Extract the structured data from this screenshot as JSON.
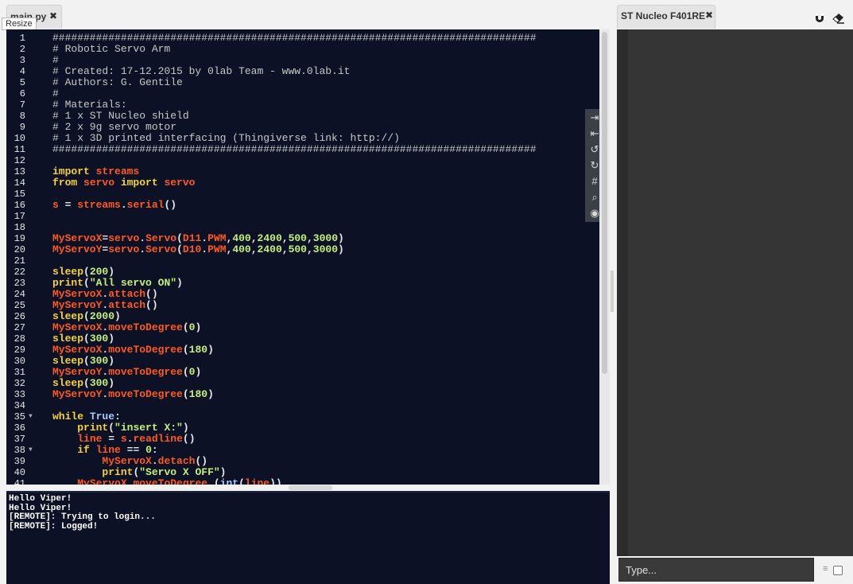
{
  "editor_tab": {
    "label": "main.py",
    "close": "✖"
  },
  "resize_tooltip": "Resize",
  "code_lines": [
    {
      "n": "1",
      "tokens": [
        {
          "c": "comment",
          "t": "##############################################################################"
        }
      ]
    },
    {
      "n": "2",
      "tokens": [
        {
          "c": "comment",
          "t": "# Robotic Servo Arm"
        }
      ]
    },
    {
      "n": "3",
      "tokens": [
        {
          "c": "comment",
          "t": "#"
        }
      ]
    },
    {
      "n": "4",
      "tokens": [
        {
          "c": "comment",
          "t": "# Created: 17-12.2015 by 0lab Team - www.0lab.it"
        }
      ]
    },
    {
      "n": "5",
      "tokens": [
        {
          "c": "comment",
          "t": "# Authors: G. Gentile"
        }
      ]
    },
    {
      "n": "6",
      "tokens": [
        {
          "c": "comment",
          "t": "#"
        }
      ]
    },
    {
      "n": "7",
      "tokens": [
        {
          "c": "comment",
          "t": "# Materials:"
        }
      ]
    },
    {
      "n": "8",
      "tokens": [
        {
          "c": "comment",
          "t": "# 1 x ST Nucleo shield"
        }
      ]
    },
    {
      "n": "9",
      "tokens": [
        {
          "c": "comment",
          "t": "# 2 x 9g servo motor"
        }
      ]
    },
    {
      "n": "10",
      "tokens": [
        {
          "c": "comment",
          "t": "# 1 x 3D printed interfacing (Thingiverse link: http://)"
        }
      ]
    },
    {
      "n": "11",
      "tokens": [
        {
          "c": "comment",
          "t": "##############################################################################"
        }
      ]
    },
    {
      "n": "12",
      "tokens": []
    },
    {
      "n": "13",
      "tokens": [
        {
          "c": "kw",
          "t": "import "
        },
        {
          "c": "name",
          "t": "streams"
        }
      ]
    },
    {
      "n": "14",
      "tokens": [
        {
          "c": "kw",
          "t": "from "
        },
        {
          "c": "name",
          "t": "servo "
        },
        {
          "c": "kw",
          "t": "import "
        },
        {
          "c": "name",
          "t": "servo"
        }
      ]
    },
    {
      "n": "15",
      "tokens": []
    },
    {
      "n": "16",
      "tokens": [
        {
          "c": "name",
          "t": "s"
        },
        {
          "c": "op",
          "t": " = "
        },
        {
          "c": "name",
          "t": "streams"
        },
        {
          "c": "op",
          "t": "."
        },
        {
          "c": "name",
          "t": "serial"
        },
        {
          "c": "op",
          "t": "()"
        }
      ]
    },
    {
      "n": "17",
      "tokens": []
    },
    {
      "n": "18",
      "tokens": []
    },
    {
      "n": "19",
      "tokens": [
        {
          "c": "name",
          "t": "MyServoX"
        },
        {
          "c": "op",
          "t": "="
        },
        {
          "c": "name",
          "t": "servo"
        },
        {
          "c": "op",
          "t": "."
        },
        {
          "c": "name",
          "t": "Servo"
        },
        {
          "c": "op",
          "t": "("
        },
        {
          "c": "name",
          "t": "D11"
        },
        {
          "c": "op",
          "t": "."
        },
        {
          "c": "name",
          "t": "PWM"
        },
        {
          "c": "op",
          "t": ","
        },
        {
          "c": "num",
          "t": "400"
        },
        {
          "c": "op",
          "t": ","
        },
        {
          "c": "num",
          "t": "2400"
        },
        {
          "c": "op",
          "t": ","
        },
        {
          "c": "num",
          "t": "500"
        },
        {
          "c": "op",
          "t": ","
        },
        {
          "c": "num",
          "t": "3000"
        },
        {
          "c": "op",
          "t": ")"
        }
      ]
    },
    {
      "n": "20",
      "tokens": [
        {
          "c": "name",
          "t": "MyServoY"
        },
        {
          "c": "op",
          "t": "="
        },
        {
          "c": "name",
          "t": "servo"
        },
        {
          "c": "op",
          "t": "."
        },
        {
          "c": "name",
          "t": "Servo"
        },
        {
          "c": "op",
          "t": "("
        },
        {
          "c": "name",
          "t": "D10"
        },
        {
          "c": "op",
          "t": "."
        },
        {
          "c": "name",
          "t": "PWM"
        },
        {
          "c": "op",
          "t": ","
        },
        {
          "c": "num",
          "t": "400"
        },
        {
          "c": "op",
          "t": ","
        },
        {
          "c": "num",
          "t": "2400"
        },
        {
          "c": "op",
          "t": ","
        },
        {
          "c": "num",
          "t": "500"
        },
        {
          "c": "op",
          "t": ","
        },
        {
          "c": "num",
          "t": "3000"
        },
        {
          "c": "op",
          "t": ")"
        }
      ]
    },
    {
      "n": "21",
      "tokens": []
    },
    {
      "n": "22",
      "tokens": [
        {
          "c": "kw",
          "t": "sleep"
        },
        {
          "c": "op",
          "t": "("
        },
        {
          "c": "num",
          "t": "200"
        },
        {
          "c": "op",
          "t": ")"
        }
      ]
    },
    {
      "n": "23",
      "tokens": [
        {
          "c": "kw",
          "t": "print"
        },
        {
          "c": "op",
          "t": "("
        },
        {
          "c": "str",
          "t": "\"All servo ON\""
        },
        {
          "c": "op",
          "t": ")"
        }
      ]
    },
    {
      "n": "24",
      "tokens": [
        {
          "c": "name",
          "t": "MyServoX"
        },
        {
          "c": "op",
          "t": "."
        },
        {
          "c": "name",
          "t": "attach"
        },
        {
          "c": "op",
          "t": "()"
        }
      ]
    },
    {
      "n": "25",
      "tokens": [
        {
          "c": "name",
          "t": "MyServoY"
        },
        {
          "c": "op",
          "t": "."
        },
        {
          "c": "name",
          "t": "attach"
        },
        {
          "c": "op",
          "t": "()"
        }
      ]
    },
    {
      "n": "26",
      "tokens": [
        {
          "c": "kw",
          "t": "sleep"
        },
        {
          "c": "op",
          "t": "("
        },
        {
          "c": "num",
          "t": "2000"
        },
        {
          "c": "op",
          "t": ")"
        }
      ]
    },
    {
      "n": "27",
      "tokens": [
        {
          "c": "name",
          "t": "MyServoX"
        },
        {
          "c": "op",
          "t": "."
        },
        {
          "c": "name",
          "t": "moveToDegree"
        },
        {
          "c": "op",
          "t": "("
        },
        {
          "c": "num",
          "t": "0"
        },
        {
          "c": "op",
          "t": ")"
        }
      ]
    },
    {
      "n": "28",
      "tokens": [
        {
          "c": "kw",
          "t": "sleep"
        },
        {
          "c": "op",
          "t": "("
        },
        {
          "c": "num",
          "t": "300"
        },
        {
          "c": "op",
          "t": ")"
        }
      ]
    },
    {
      "n": "29",
      "tokens": [
        {
          "c": "name",
          "t": "MyServoX"
        },
        {
          "c": "op",
          "t": "."
        },
        {
          "c": "name",
          "t": "moveToDegree"
        },
        {
          "c": "op",
          "t": "("
        },
        {
          "c": "num",
          "t": "180"
        },
        {
          "c": "op",
          "t": ")"
        }
      ]
    },
    {
      "n": "30",
      "tokens": [
        {
          "c": "kw",
          "t": "sleep"
        },
        {
          "c": "op",
          "t": "("
        },
        {
          "c": "num",
          "t": "300"
        },
        {
          "c": "op",
          "t": ")"
        }
      ]
    },
    {
      "n": "31",
      "tokens": [
        {
          "c": "name",
          "t": "MyServoY"
        },
        {
          "c": "op",
          "t": "."
        },
        {
          "c": "name",
          "t": "moveToDegree"
        },
        {
          "c": "op",
          "t": "("
        },
        {
          "c": "num",
          "t": "0"
        },
        {
          "c": "op",
          "t": ")"
        }
      ]
    },
    {
      "n": "32",
      "tokens": [
        {
          "c": "kw",
          "t": "sleep"
        },
        {
          "c": "op",
          "t": "("
        },
        {
          "c": "num",
          "t": "300"
        },
        {
          "c": "op",
          "t": ")"
        }
      ]
    },
    {
      "n": "33",
      "tokens": [
        {
          "c": "name",
          "t": "MyServoY"
        },
        {
          "c": "op",
          "t": "."
        },
        {
          "c": "name",
          "t": "moveToDegree"
        },
        {
          "c": "op",
          "t": "("
        },
        {
          "c": "num",
          "t": "180"
        },
        {
          "c": "op",
          "t": ")"
        }
      ]
    },
    {
      "n": "34",
      "tokens": []
    },
    {
      "n": "35",
      "fold": true,
      "tokens": [
        {
          "c": "kw",
          "t": "while "
        },
        {
          "c": "const",
          "t": "True"
        },
        {
          "c": "op",
          "t": ":"
        }
      ]
    },
    {
      "n": "36",
      "tokens": [
        {
          "c": "plain",
          "t": "    "
        },
        {
          "c": "kw",
          "t": "print"
        },
        {
          "c": "op",
          "t": "("
        },
        {
          "c": "str",
          "t": "\"insert X:\""
        },
        {
          "c": "op",
          "t": ")"
        }
      ]
    },
    {
      "n": "37",
      "tokens": [
        {
          "c": "plain",
          "t": "    "
        },
        {
          "c": "name",
          "t": "line"
        },
        {
          "c": "op",
          "t": " = "
        },
        {
          "c": "name",
          "t": "s"
        },
        {
          "c": "op",
          "t": "."
        },
        {
          "c": "name",
          "t": "readline"
        },
        {
          "c": "op",
          "t": "()"
        }
      ]
    },
    {
      "n": "38",
      "fold": true,
      "tokens": [
        {
          "c": "plain",
          "t": "    "
        },
        {
          "c": "kw",
          "t": "if "
        },
        {
          "c": "name",
          "t": "line"
        },
        {
          "c": "op",
          "t": " == "
        },
        {
          "c": "num",
          "t": "0"
        },
        {
          "c": "op",
          "t": ":"
        }
      ]
    },
    {
      "n": "39",
      "tokens": [
        {
          "c": "plain",
          "t": "        "
        },
        {
          "c": "name",
          "t": "MyServoX"
        },
        {
          "c": "op",
          "t": "."
        },
        {
          "c": "name",
          "t": "detach"
        },
        {
          "c": "op",
          "t": "()"
        }
      ]
    },
    {
      "n": "40",
      "tokens": [
        {
          "c": "plain",
          "t": "        "
        },
        {
          "c": "kw",
          "t": "print"
        },
        {
          "c": "op",
          "t": "("
        },
        {
          "c": "str",
          "t": "\"Servo X OFF\""
        },
        {
          "c": "op",
          "t": ")"
        }
      ]
    },
    {
      "n": "41",
      "tokens": [
        {
          "c": "plain",
          "t": "    "
        },
        {
          "c": "name",
          "t": "MyServoX"
        },
        {
          "c": "op",
          "t": "."
        },
        {
          "c": "name",
          "t": "moveToDegree"
        },
        {
          "c": "op",
          "t": " ("
        },
        {
          "c": "const",
          "t": "int"
        },
        {
          "c": "op",
          "t": "("
        },
        {
          "c": "name",
          "t": "line"
        },
        {
          "c": "op",
          "t": "))"
        }
      ]
    }
  ],
  "editor_toolbar": [
    {
      "name": "indent-icon",
      "glyph": "⇥"
    },
    {
      "name": "outdent-icon",
      "glyph": "⇤"
    },
    {
      "name": "undo-icon",
      "glyph": "↺"
    },
    {
      "name": "redo-icon",
      "glyph": "↻"
    },
    {
      "name": "hash-icon",
      "glyph": "#"
    },
    {
      "name": "search-icon",
      "glyph": "⌕"
    },
    {
      "name": "target-icon",
      "glyph": "◉"
    }
  ],
  "console_lines": [
    "Hello Viper!",
    "Hello Viper!",
    "[REMOTE]: Trying to login...",
    "[REMOTE]: Logged!"
  ],
  "device_tab": {
    "label": "ST Nucleo F401RE",
    "close": "✖"
  },
  "serial": {
    "placeholder": "Type..."
  },
  "colors": {
    "editor_bg": "#0c1125",
    "keyword": "#f5d23c",
    "name": "#ff5a1f",
    "number": "#c6f07a",
    "serial_bg": "#353535"
  }
}
